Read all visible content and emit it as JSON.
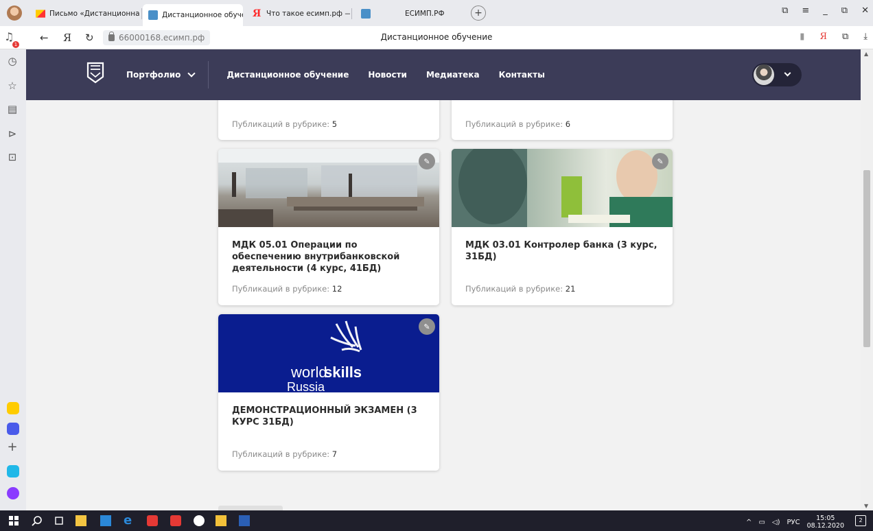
{
  "browser": {
    "tabs": [
      {
        "title": "Письмо «Дистанционная",
        "icon": "mail-icon"
      },
      {
        "title": "Дистанционное обучен",
        "icon": "book-icon",
        "active": true
      },
      {
        "title": "Что такое есимп.рф — Ян",
        "icon": "yandex-icon"
      },
      {
        "title": "",
        "icon": "book-icon"
      },
      {
        "title": "ЕСИМП.РФ",
        "icon": ""
      }
    ],
    "new_tab": "+",
    "window_controls": [
      "⧉",
      "≡",
      "_",
      "⧉",
      "✕"
    ],
    "address": {
      "url": "66000168.есимп.рф",
      "page_title": "Дистанционное обучение",
      "back": "←",
      "yandex": "Я",
      "reload": "↻"
    },
    "addr_right_icons": [
      "▮",
      "Я",
      "⧉",
      "⤓"
    ],
    "notification_count": "1"
  },
  "site": {
    "nav": {
      "portfolio": "Портфолио",
      "links": [
        "Дистанционное обучение",
        "Новости",
        "Медиатека",
        "Контакты"
      ]
    }
  },
  "cards_top": [
    {
      "count_label": "Публикаций в рубрике:",
      "count": "5"
    },
    {
      "count_label": "Публикаций в рубрике:",
      "count": "6"
    }
  ],
  "cards": [
    {
      "title": "МДК 05.01 Операции по обеспечению внутрибанковской деятельности (4 курс, 41БД)",
      "count_label": "Публикаций в рубрике:",
      "count": "12"
    },
    {
      "title": "МДК 03.01 Контролер банка (3 курс, 31БД)",
      "count_label": "Публикаций в рубрике:",
      "count": "21"
    },
    {
      "title": "ДЕМОНСТРАЦИОННЫЙ ЭКЗАМЕН (3 КУРС 31БД)",
      "count_label": "Публикаций в рубрике:",
      "count": "7",
      "image_text": {
        "world": "world",
        "skills": "skills",
        "russia": "Russia"
      }
    }
  ],
  "taskbar": {
    "lang": "РУС",
    "time": "15:05",
    "date": "08.12.2020",
    "notifications": "2"
  },
  "colors": {
    "header_bg": "#3c3c58",
    "page_bg": "#f2f2f2",
    "worldskills_bg": "#0a1d8f"
  }
}
